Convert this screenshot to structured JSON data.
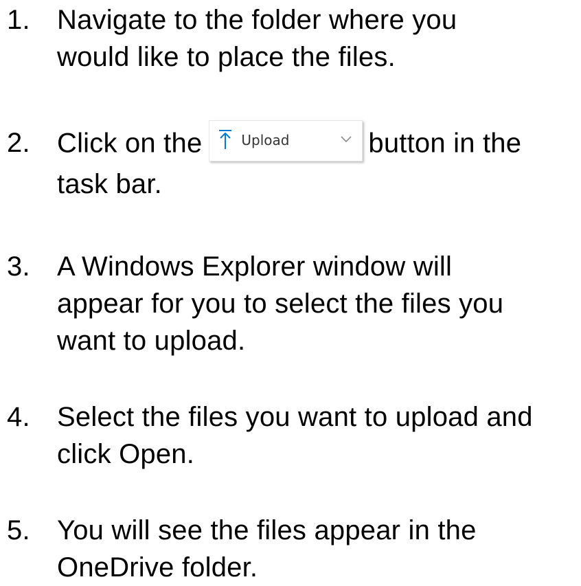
{
  "steps": [
    {
      "number": "1.",
      "lines": [
        "Navigate to the folder where you",
        "would like to place the files."
      ]
    },
    {
      "number": "2.",
      "before": "Click on the",
      "after": "button in the",
      "line2": "task bar.",
      "upload_button": {
        "label": "Upload",
        "icon": "upload-arrow-icon",
        "dropdown_icon": "chevron-down-icon",
        "accent_color": "#0078d4"
      }
    },
    {
      "number": "3.",
      "lines": [
        "A Windows Explorer window will",
        "appear for you to select the files you",
        "want to upload."
      ]
    },
    {
      "number": "4.",
      "lines": [
        "Select the files you want to upload and",
        "click Open."
      ]
    },
    {
      "number": "5.",
      "lines": [
        "You will see the files appear in the",
        "OneDrive folder."
      ]
    }
  ]
}
